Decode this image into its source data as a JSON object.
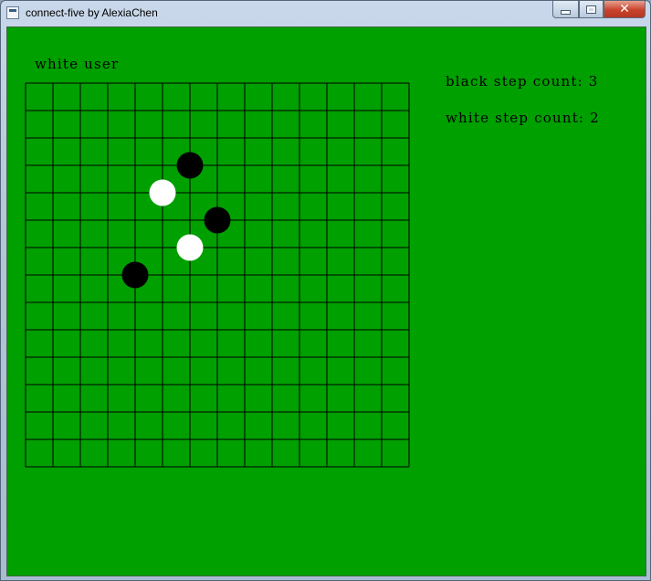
{
  "window": {
    "title": "connect-five by AlexiaChen",
    "controls": {
      "minimize_icon": "minimize-icon",
      "maximize_icon": "maximize-icon",
      "close_icon": "close-icon",
      "close_glyph": "✕"
    }
  },
  "game": {
    "current_turn_label": "white user",
    "black_step_label": "black step count: 3",
    "white_step_label": "white step count: 2",
    "board_color": "#00a000",
    "grid_line_color": "#000000",
    "board_cells": 14,
    "stones": [
      {
        "color": "black",
        "col": 6,
        "row": 3
      },
      {
        "color": "white",
        "col": 5,
        "row": 4
      },
      {
        "color": "black",
        "col": 7,
        "row": 5
      },
      {
        "color": "white",
        "col": 6,
        "row": 6
      },
      {
        "color": "black",
        "col": 4,
        "row": 7
      }
    ]
  }
}
